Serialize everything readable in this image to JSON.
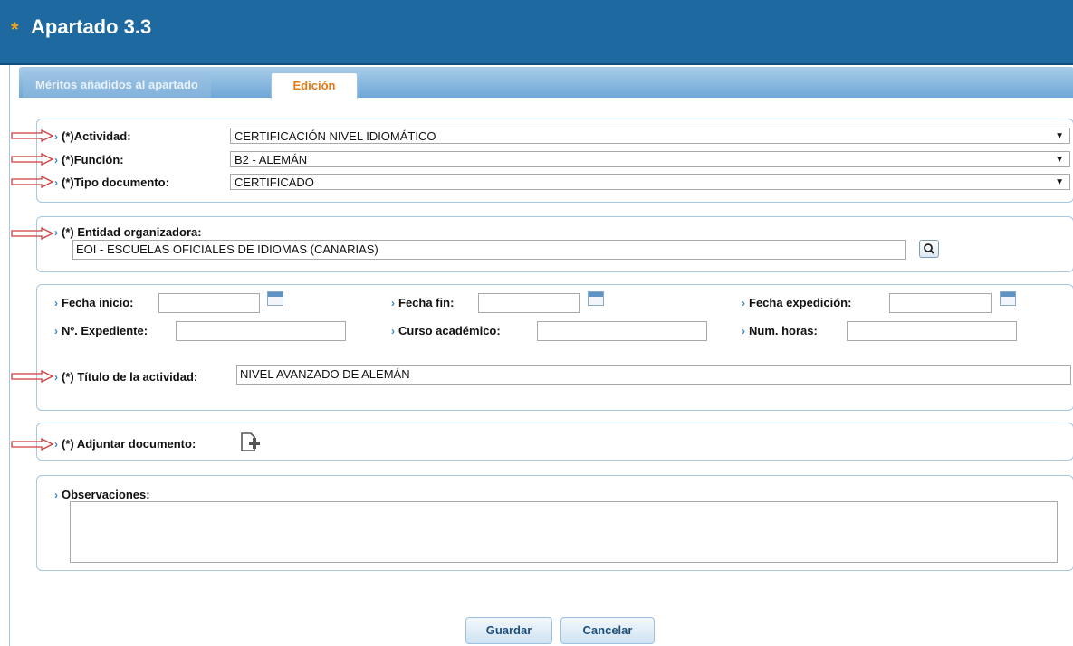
{
  "header": {
    "star": "*",
    "title": "Apartado 3.3"
  },
  "tabs": [
    {
      "label": "Méritos añadidos al apartado"
    },
    {
      "label": "Edición"
    }
  ],
  "section_activity": {
    "actividad": {
      "label": "(*)Actividad:",
      "value": "CERTIFICACIÓN NIVEL IDIOMÁTICO"
    },
    "funcion": {
      "label": "(*)Función:",
      "value": "B2 - ALEMÁN"
    },
    "tipo_documento": {
      "label": "(*)Tipo documento:",
      "value": "CERTIFICADO"
    }
  },
  "section_entidad": {
    "label": "(*) Entidad organizadora:",
    "value": "EOI - ESCUELAS OFICIALES DE IDIOMAS (CANARIAS)"
  },
  "section_dates": {
    "fecha_inicio": {
      "label": "Fecha inicio:",
      "value": ""
    },
    "fecha_fin": {
      "label": "Fecha fin:",
      "value": ""
    },
    "fecha_expedicion": {
      "label": "Fecha expedición:",
      "value": ""
    },
    "expediente": {
      "label": "Nº. Expediente:",
      "value": ""
    },
    "curso_academico": {
      "label": "Curso académico:",
      "value": ""
    },
    "num_horas": {
      "label": "Num. horas:",
      "value": ""
    },
    "titulo": {
      "label": "(*) Título de la actividad:",
      "value": "NIVEL AVANZADO DE ALEMÁN"
    }
  },
  "section_adjuntar": {
    "label": "(*) Adjuntar documento:"
  },
  "section_observaciones": {
    "label": "Observaciones:",
    "value": ""
  },
  "buttons": {
    "guardar": "Guardar",
    "cancelar": "Cancelar"
  },
  "colors": {
    "header_bg": "#1e6aa0",
    "accent_orange": "#e37a12",
    "chevron_blue": "#3a87c9",
    "arrow_red": "#d33c3c"
  },
  "icons": {
    "chevron": "›",
    "caret": "▼"
  }
}
